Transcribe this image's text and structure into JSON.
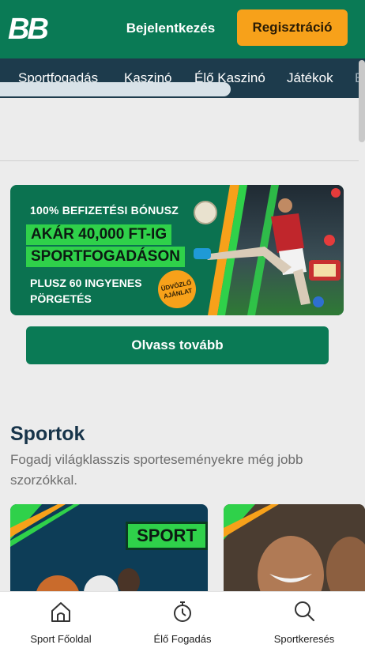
{
  "header": {
    "logo_text": "BB",
    "login_label": "Bejelentkezés",
    "register_label": "Regisztráció"
  },
  "nav": {
    "items": [
      "Sportfogadás",
      "Kaszinó",
      "Élő Kaszinó",
      "Játékok"
    ]
  },
  "banner": {
    "line1": "100% BEFIZETÉSI BÓNUSZ",
    "headline1": "AKÁR 40,000 FT-IG",
    "headline2": "SPORTFOGADÁSON",
    "line3a": "PLUSZ 60 INGYENES",
    "line3b": "PÖRGETÉS",
    "badge_a": "ÜDVÖZLŐ",
    "badge_b": "AJÁNLAT"
  },
  "read_more_label": "Olvass tovább",
  "sports_section": {
    "title": "Sportok",
    "subtitle": "Fogadj világklasszis sporteseményekre még jobb szorzókkal.",
    "cards": [
      {
        "label": "SPORT"
      },
      {
        "label": ""
      }
    ]
  },
  "bottom_nav": {
    "items": [
      {
        "label": "Sport Főoldal",
        "icon": "home-icon"
      },
      {
        "label": "Élő Fogadás",
        "icon": "stopwatch-icon"
      },
      {
        "label": "Sportkeresés",
        "icon": "search-icon"
      }
    ]
  },
  "colors": {
    "brand_green": "#0a7a55",
    "accent_orange": "#f7a11a",
    "nav_navy": "#1d3b4c",
    "highlight_green": "#2fd14a"
  }
}
